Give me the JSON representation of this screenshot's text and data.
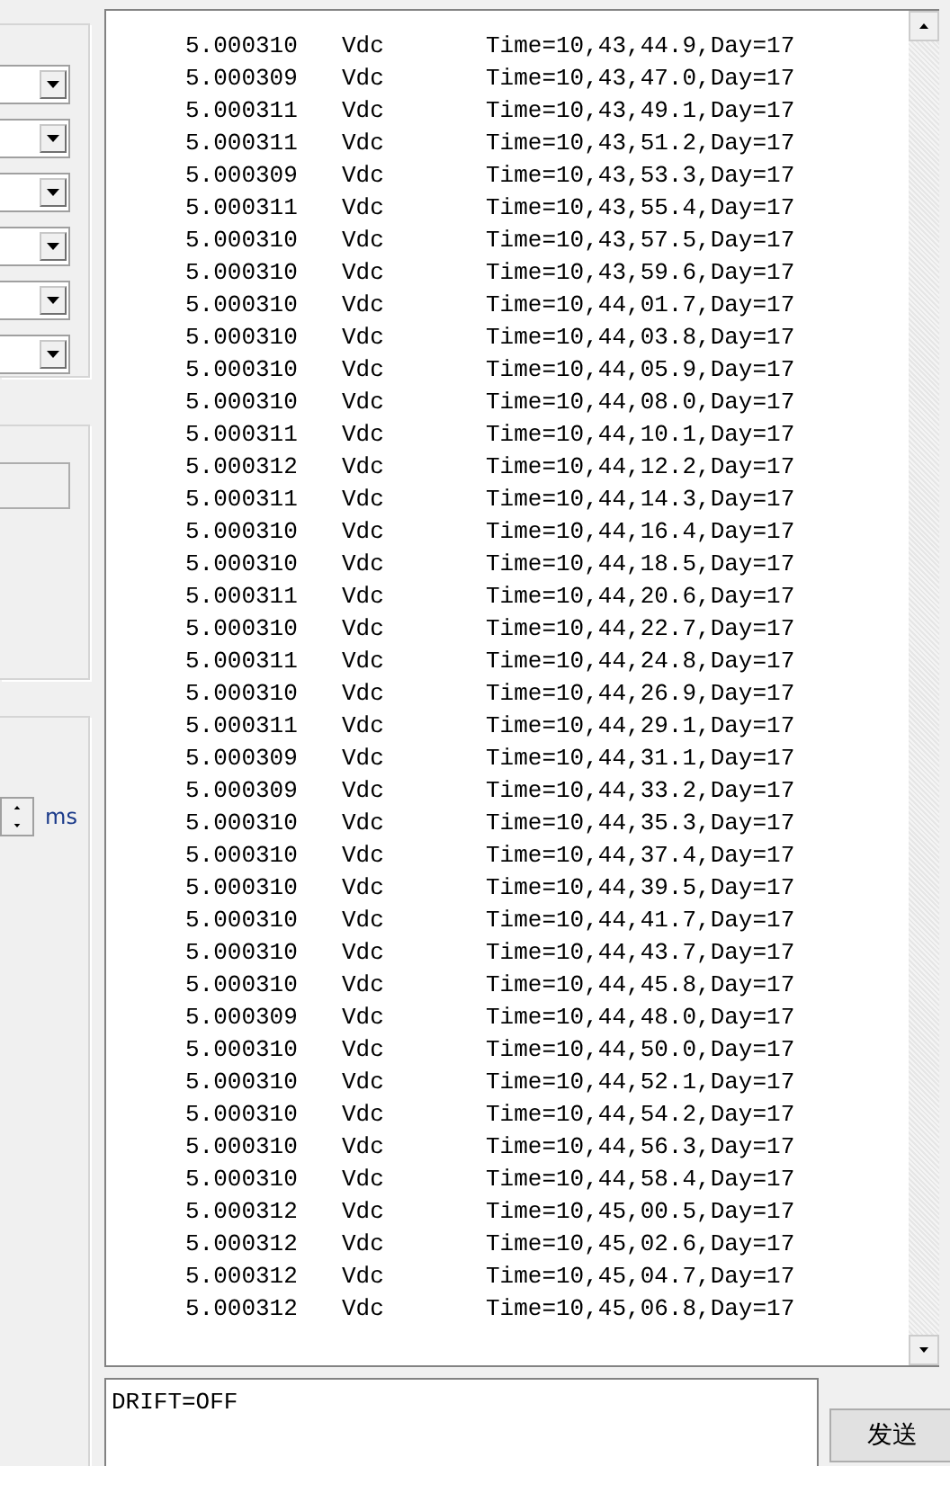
{
  "left_panel": {
    "spinner_unit": "ms"
  },
  "log": {
    "rows": [
      {
        "value": "5.000310",
        "unit": "Vdc",
        "time": "Time=10,43,44.9,Day=17"
      },
      {
        "value": "5.000309",
        "unit": "Vdc",
        "time": "Time=10,43,47.0,Day=17"
      },
      {
        "value": "5.000311",
        "unit": "Vdc",
        "time": "Time=10,43,49.1,Day=17"
      },
      {
        "value": "5.000311",
        "unit": "Vdc",
        "time": "Time=10,43,51.2,Day=17"
      },
      {
        "value": "5.000309",
        "unit": "Vdc",
        "time": "Time=10,43,53.3,Day=17"
      },
      {
        "value": "5.000311",
        "unit": "Vdc",
        "time": "Time=10,43,55.4,Day=17"
      },
      {
        "value": "5.000310",
        "unit": "Vdc",
        "time": "Time=10,43,57.5,Day=17"
      },
      {
        "value": "5.000310",
        "unit": "Vdc",
        "time": "Time=10,43,59.6,Day=17"
      },
      {
        "value": "5.000310",
        "unit": "Vdc",
        "time": "Time=10,44,01.7,Day=17"
      },
      {
        "value": "5.000310",
        "unit": "Vdc",
        "time": "Time=10,44,03.8,Day=17"
      },
      {
        "value": "5.000310",
        "unit": "Vdc",
        "time": "Time=10,44,05.9,Day=17"
      },
      {
        "value": "5.000310",
        "unit": "Vdc",
        "time": "Time=10,44,08.0,Day=17"
      },
      {
        "value": "5.000311",
        "unit": "Vdc",
        "time": "Time=10,44,10.1,Day=17"
      },
      {
        "value": "5.000312",
        "unit": "Vdc",
        "time": "Time=10,44,12.2,Day=17"
      },
      {
        "value": "5.000311",
        "unit": "Vdc",
        "time": "Time=10,44,14.3,Day=17"
      },
      {
        "value": "5.000310",
        "unit": "Vdc",
        "time": "Time=10,44,16.4,Day=17"
      },
      {
        "value": "5.000310",
        "unit": "Vdc",
        "time": "Time=10,44,18.5,Day=17"
      },
      {
        "value": "5.000311",
        "unit": "Vdc",
        "time": "Time=10,44,20.6,Day=17"
      },
      {
        "value": "5.000310",
        "unit": "Vdc",
        "time": "Time=10,44,22.7,Day=17"
      },
      {
        "value": "5.000311",
        "unit": "Vdc",
        "time": "Time=10,44,24.8,Day=17"
      },
      {
        "value": "5.000310",
        "unit": "Vdc",
        "time": "Time=10,44,26.9,Day=17"
      },
      {
        "value": "5.000311",
        "unit": "Vdc",
        "time": "Time=10,44,29.1,Day=17"
      },
      {
        "value": "5.000309",
        "unit": "Vdc",
        "time": "Time=10,44,31.1,Day=17"
      },
      {
        "value": "5.000309",
        "unit": "Vdc",
        "time": "Time=10,44,33.2,Day=17"
      },
      {
        "value": "5.000310",
        "unit": "Vdc",
        "time": "Time=10,44,35.3,Day=17"
      },
      {
        "value": "5.000310",
        "unit": "Vdc",
        "time": "Time=10,44,37.4,Day=17"
      },
      {
        "value": "5.000310",
        "unit": "Vdc",
        "time": "Time=10,44,39.5,Day=17"
      },
      {
        "value": "5.000310",
        "unit": "Vdc",
        "time": "Time=10,44,41.7,Day=17"
      },
      {
        "value": "5.000310",
        "unit": "Vdc",
        "time": "Time=10,44,43.7,Day=17"
      },
      {
        "value": "5.000310",
        "unit": "Vdc",
        "time": "Time=10,44,45.8,Day=17"
      },
      {
        "value": "5.000309",
        "unit": "Vdc",
        "time": "Time=10,44,48.0,Day=17"
      },
      {
        "value": "5.000310",
        "unit": "Vdc",
        "time": "Time=10,44,50.0,Day=17"
      },
      {
        "value": "5.000310",
        "unit": "Vdc",
        "time": "Time=10,44,52.1,Day=17"
      },
      {
        "value": "5.000310",
        "unit": "Vdc",
        "time": "Time=10,44,54.2,Day=17"
      },
      {
        "value": "5.000310",
        "unit": "Vdc",
        "time": "Time=10,44,56.3,Day=17"
      },
      {
        "value": "5.000310",
        "unit": "Vdc",
        "time": "Time=10,44,58.4,Day=17"
      },
      {
        "value": "5.000312",
        "unit": "Vdc",
        "time": "Time=10,45,00.5,Day=17"
      },
      {
        "value": "5.000312",
        "unit": "Vdc",
        "time": "Time=10,45,02.6,Day=17"
      },
      {
        "value": "5.000312",
        "unit": "Vdc",
        "time": "Time=10,45,04.7,Day=17"
      },
      {
        "value": "5.000312",
        "unit": "Vdc",
        "time": "Time=10,45,06.8,Day=17"
      }
    ]
  },
  "command": {
    "value": "DRIFT=OFF"
  },
  "send_button": {
    "label": "发送"
  }
}
